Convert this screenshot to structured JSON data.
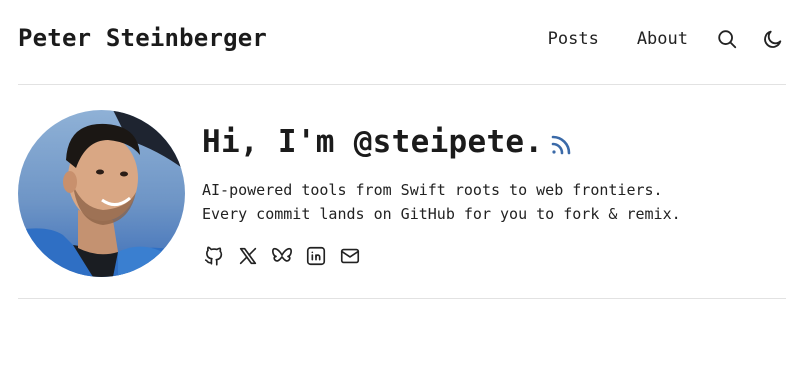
{
  "header": {
    "site_title": "Peter Steinberger",
    "nav": {
      "posts": "Posts",
      "about": "About"
    },
    "icons": {
      "search": "search-icon",
      "theme": "moon-icon"
    }
  },
  "profile": {
    "greeting": "Hi, I'm @steipete.",
    "tagline_line1": "AI-powered tools from Swift roots to web frontiers.",
    "tagline_line2": "Every commit lands on GitHub for you to fork & remix.",
    "rss_icon": "rss-icon",
    "socials": [
      "github-icon",
      "x-icon",
      "bluesky-icon",
      "linkedin-icon",
      "mail-icon"
    ]
  },
  "colors": {
    "text": "#1b1b1b",
    "accent": "#3b6aa8",
    "divider": "#e2e2e2",
    "background": "#ffffff"
  }
}
